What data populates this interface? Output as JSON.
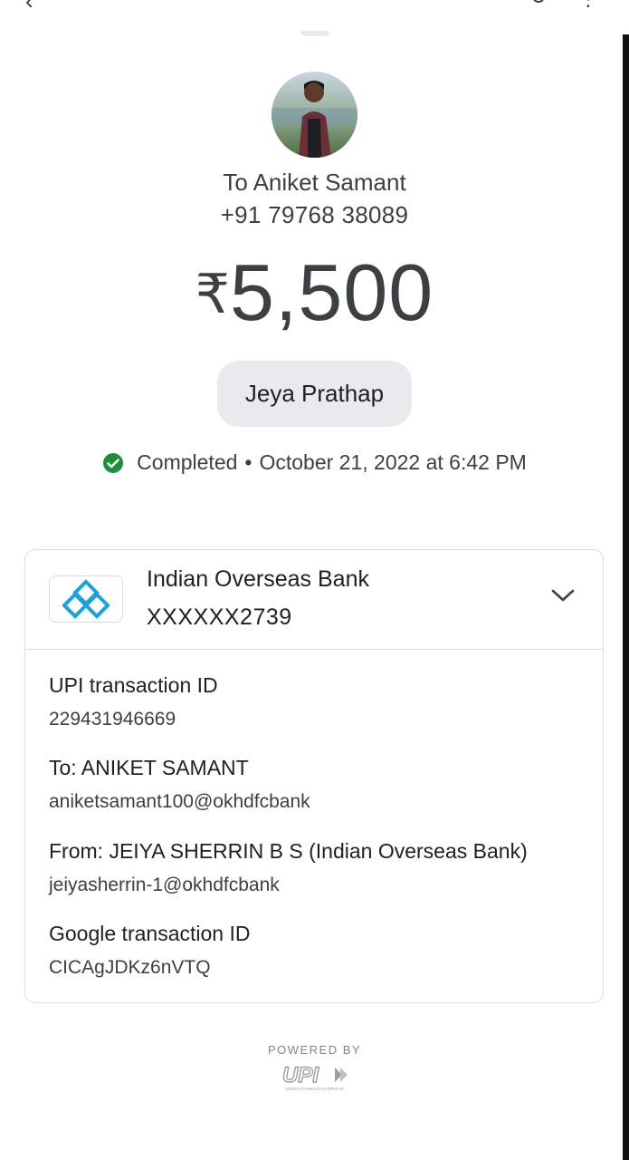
{
  "payee": {
    "name": "To Aniket Samant",
    "phone": "+91 79768 38089"
  },
  "amount": {
    "currency": "₹",
    "value": "5,500"
  },
  "note": "Jeya Prathap",
  "status": {
    "label": "Completed",
    "separator": "•",
    "datetime": "October 21, 2022 at 6:42 PM",
    "color": "#1e8e3e"
  },
  "bank": {
    "name": "Indian Overseas Bank",
    "account": "XXXXXX2739"
  },
  "details": [
    {
      "label": "UPI transaction ID",
      "value": "229431946669"
    },
    {
      "label": "To: ANIKET SAMANT",
      "value": "aniketsamant100@okhdfcbank"
    },
    {
      "label": "From: JEIYA SHERRIN B S (Indian Overseas Bank)",
      "value": "jeiyasherrin-1@okhdfcbank"
    },
    {
      "label": "Google transaction ID",
      "value": "CICAgJDKz6nVTQ"
    }
  ],
  "footer": {
    "powered_by": "POWERED BY",
    "upi_logo": "UPI",
    "upi_tagline": "UNIFIED PAYMENTS INTERFACE"
  },
  "icons": {
    "back": "back-arrow-icon",
    "help": "help-icon",
    "menu": "more-vert-icon",
    "check": "check-circle-icon",
    "expand": "chevron-down-icon"
  }
}
